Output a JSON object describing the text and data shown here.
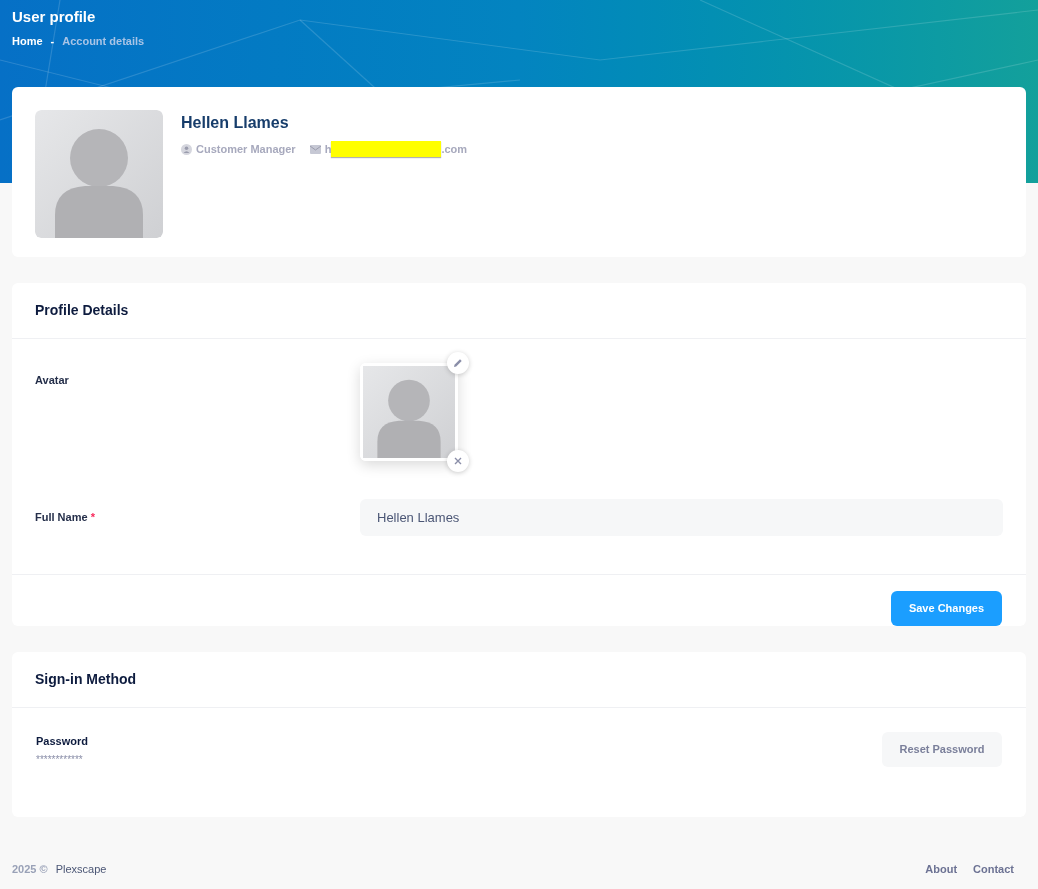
{
  "header": {
    "title": "User profile",
    "breadcrumb": [
      {
        "label": "Home",
        "selected": false
      },
      {
        "label": "-",
        "selected": false
      },
      {
        "label": "Account details",
        "selected": true
      }
    ]
  },
  "profile": {
    "name": "Hellen Llames",
    "role": "Customer Manager",
    "email_start": "h",
    "email_end": ".com",
    "email_redacted": true
  },
  "profile_details": {
    "title": "Profile Details",
    "avatar_label": "Avatar",
    "full_name_label": "Full Name",
    "required_mark": "*",
    "full_name_value": "Hellen Llames",
    "save_button": "Save Changes"
  },
  "sign_in": {
    "title": "Sign-in Method",
    "password_label": "Password",
    "password_value": "************",
    "reset_button": "Reset Password"
  },
  "footer": {
    "year": "2025 ©",
    "brand": "Plexscape",
    "links": [
      "About",
      "Contact"
    ]
  }
}
